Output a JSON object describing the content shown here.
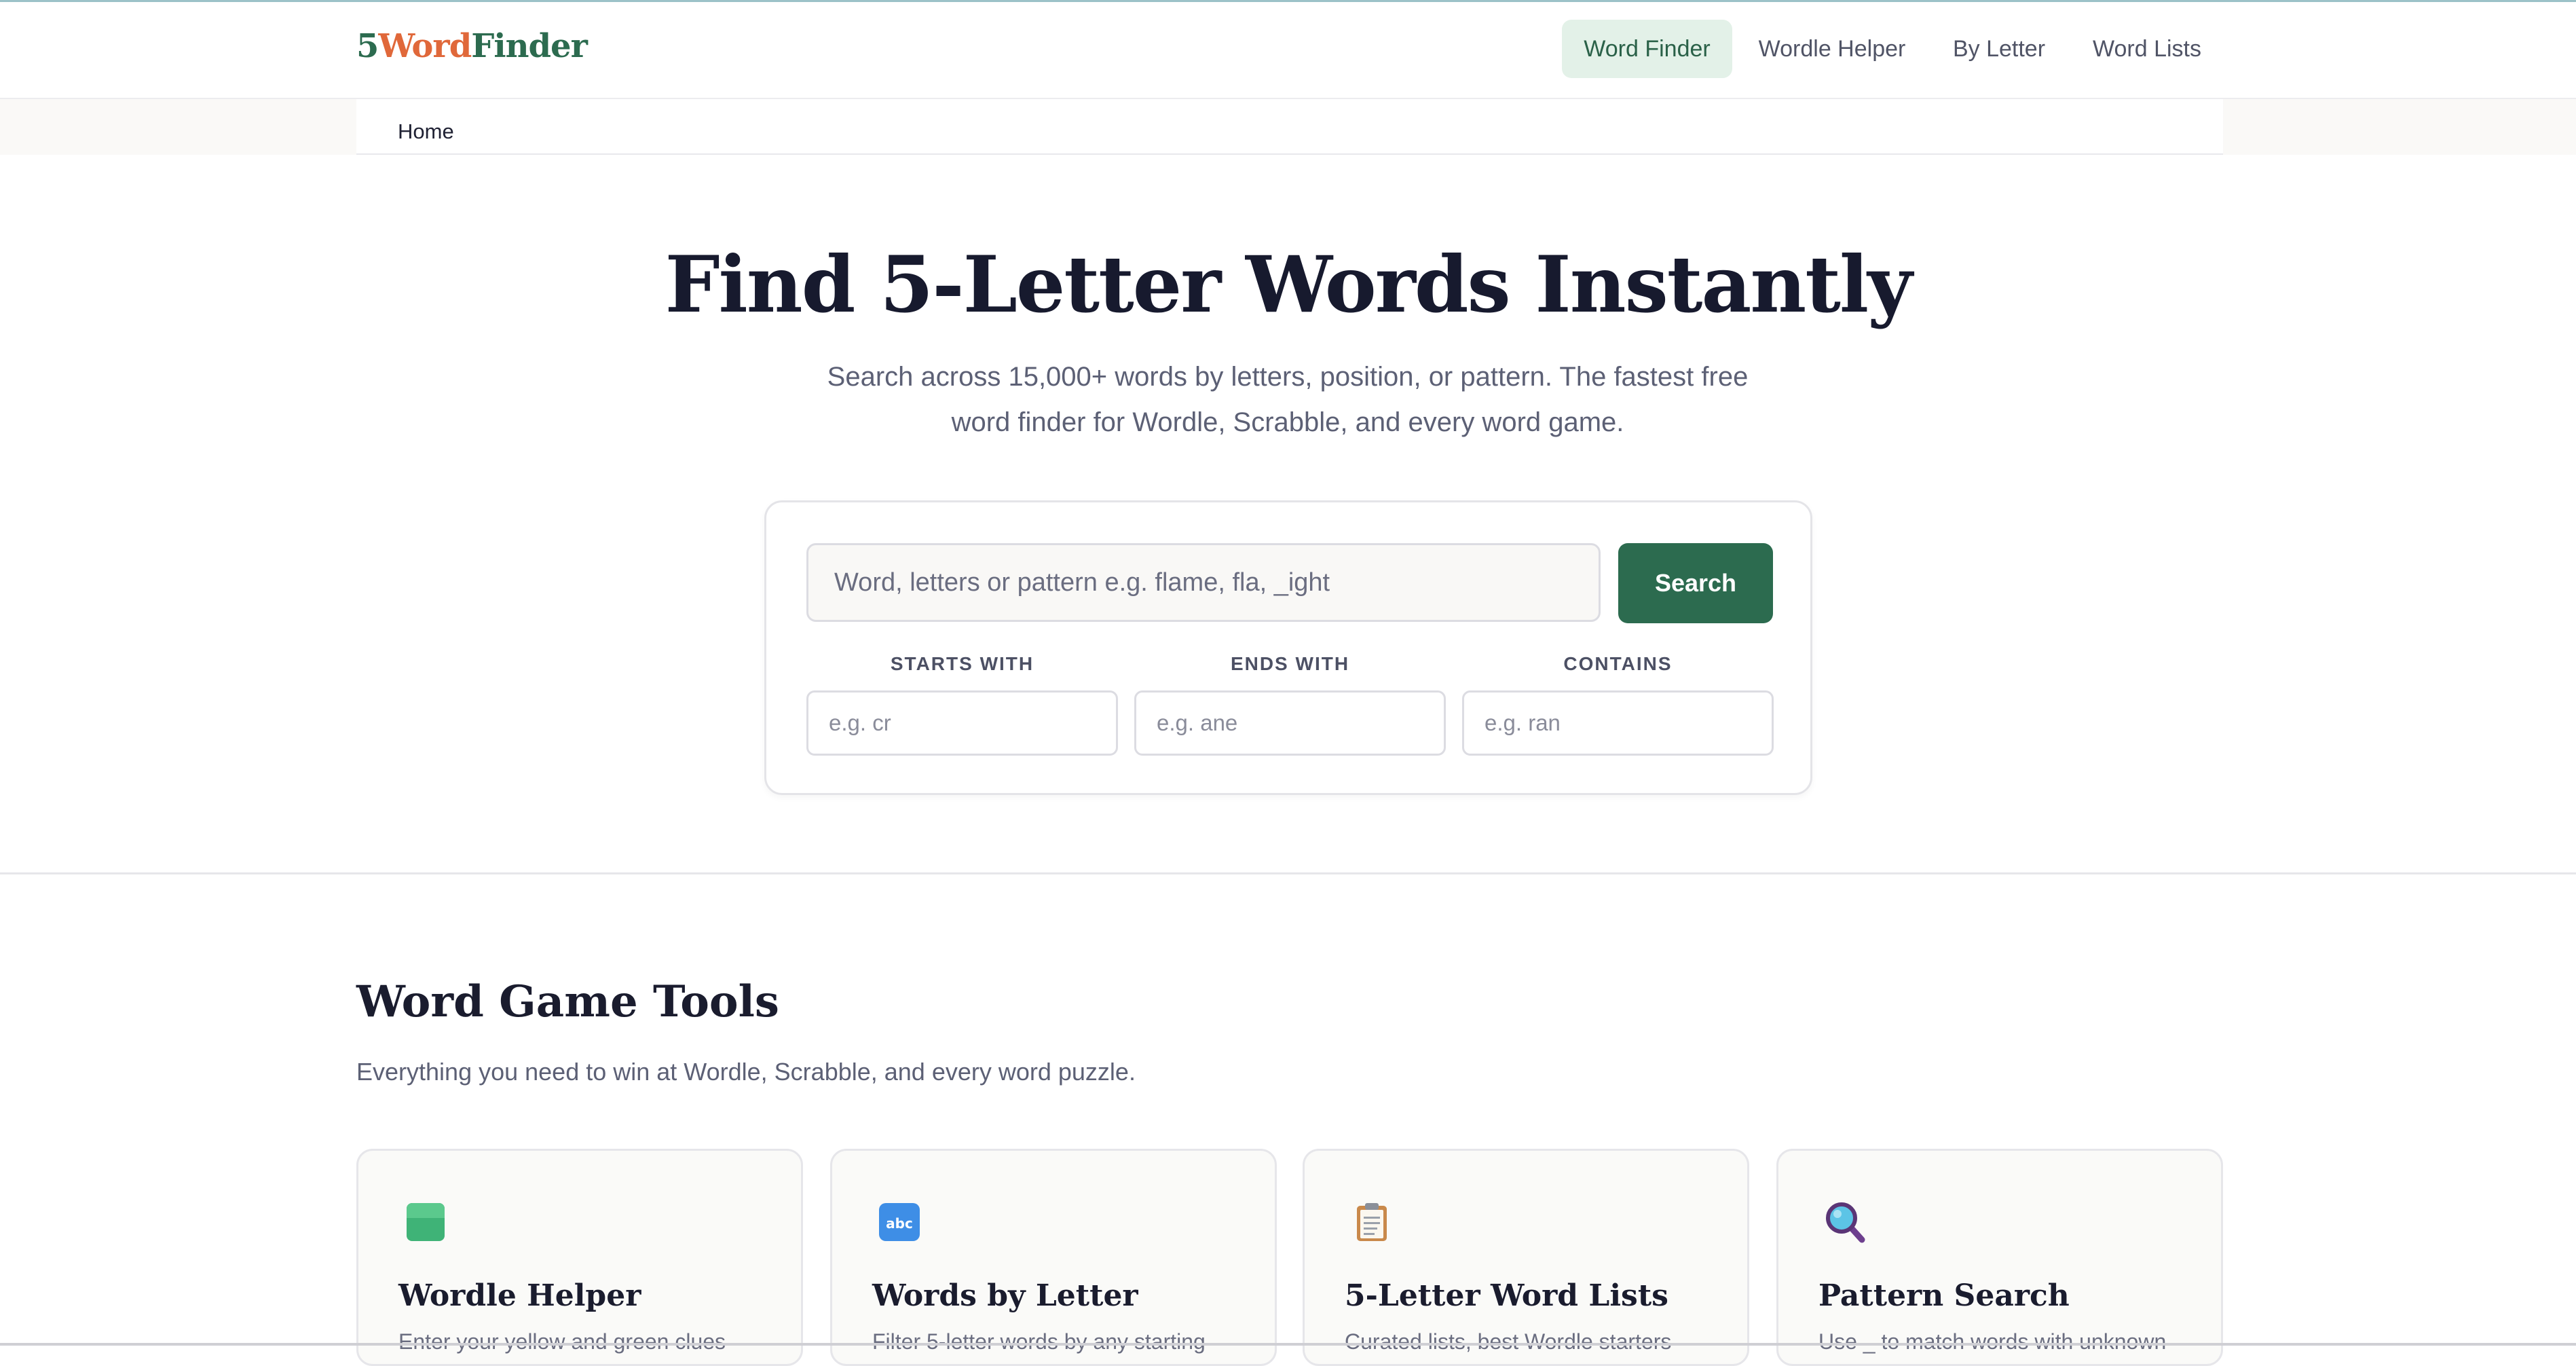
{
  "logo": {
    "part1": "5",
    "part2": "Word",
    "part3": "Finder"
  },
  "nav": [
    {
      "label": "Word Finder",
      "active": true
    },
    {
      "label": "Wordle Helper",
      "active": false
    },
    {
      "label": "By Letter",
      "active": false
    },
    {
      "label": "Word Lists",
      "active": false
    }
  ],
  "breadcrumb": {
    "home": "Home"
  },
  "hero": {
    "title": "Find 5-Letter Words Instantly",
    "subtitle": "Search across 15,000+ words by letters, position, or pattern. The fastest free word finder for Wordle, Scrabble, and every word game."
  },
  "search": {
    "placeholder": "Word, letters or pattern e.g. flame, fla, _ight",
    "button": "Search",
    "filters": [
      {
        "label": "STARTS WITH",
        "placeholder": "e.g. cr"
      },
      {
        "label": "ENDS WITH",
        "placeholder": "e.g. ane"
      },
      {
        "label": "CONTAINS",
        "placeholder": "e.g. ran"
      }
    ]
  },
  "tools": {
    "title": "Word Game Tools",
    "subtitle": "Everything you need to win at Wordle, Scrabble, and every word puzzle.",
    "cards": [
      {
        "title": "Wordle Helper",
        "icon": "green-square-icon",
        "description": "Enter your yellow and green clues"
      },
      {
        "title": "Words by Letter",
        "icon": "abc-icon",
        "description": "Filter 5-letter words by any starting"
      },
      {
        "title": "5-Letter Word Lists",
        "icon": "clipboard-icon",
        "description": "Curated lists, best Wordle starters"
      },
      {
        "title": "Pattern Search",
        "icon": "magnifier-icon",
        "description": "Use _ to match words with unknown"
      }
    ]
  },
  "colors": {
    "brand": "#2c6b4f",
    "accent": "#e0683a",
    "nav_active_bg": "#e3f1e8"
  }
}
